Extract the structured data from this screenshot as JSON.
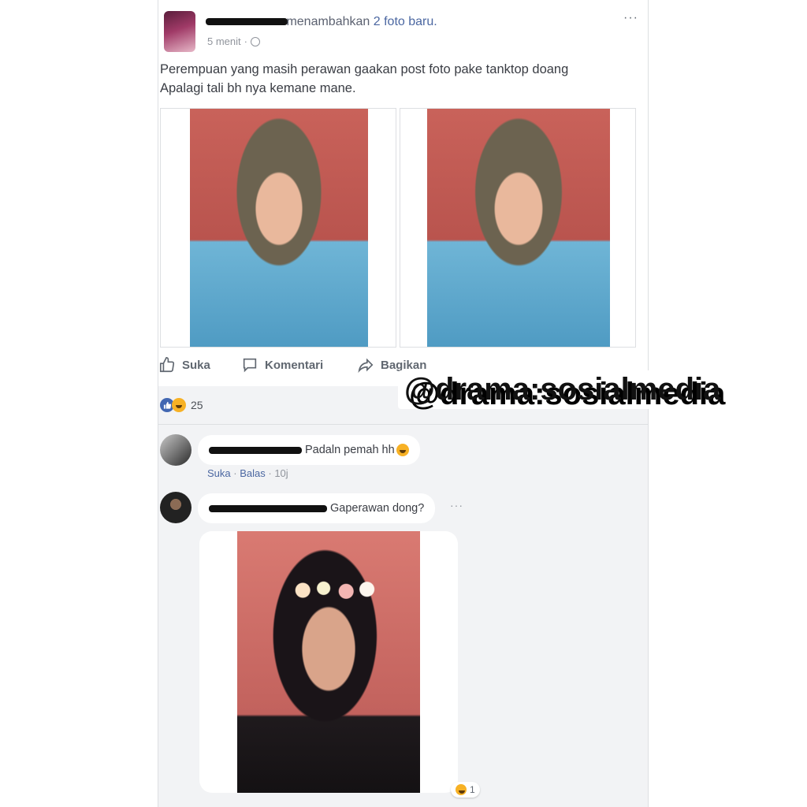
{
  "post": {
    "action_text": "menambahkan",
    "action_link": "2 foto baru.",
    "timestamp": "5 menit",
    "more_label": "···",
    "text_line1": "Perempuan yang masih perawan gaakan post foto pake tanktop doang",
    "text_line2": "Apalagi tali bh nya kemane mane.",
    "actions": {
      "like": "Suka",
      "comment": "Komentari",
      "share": "Bagikan"
    },
    "reaction_count": "25"
  },
  "comments": [
    {
      "text": "Padaln pemah hh",
      "meta_like": "Suka",
      "meta_reply": "Balas",
      "meta_time": "10j"
    },
    {
      "text": "Gaperawan dong?",
      "more_label": "···",
      "reaction_count": "1"
    }
  ],
  "watermark": "@drama:sosialmedia",
  "colors": {
    "facebook_blue": "#4267b2",
    "link": "#4b67a1",
    "muted": "#90949c"
  }
}
